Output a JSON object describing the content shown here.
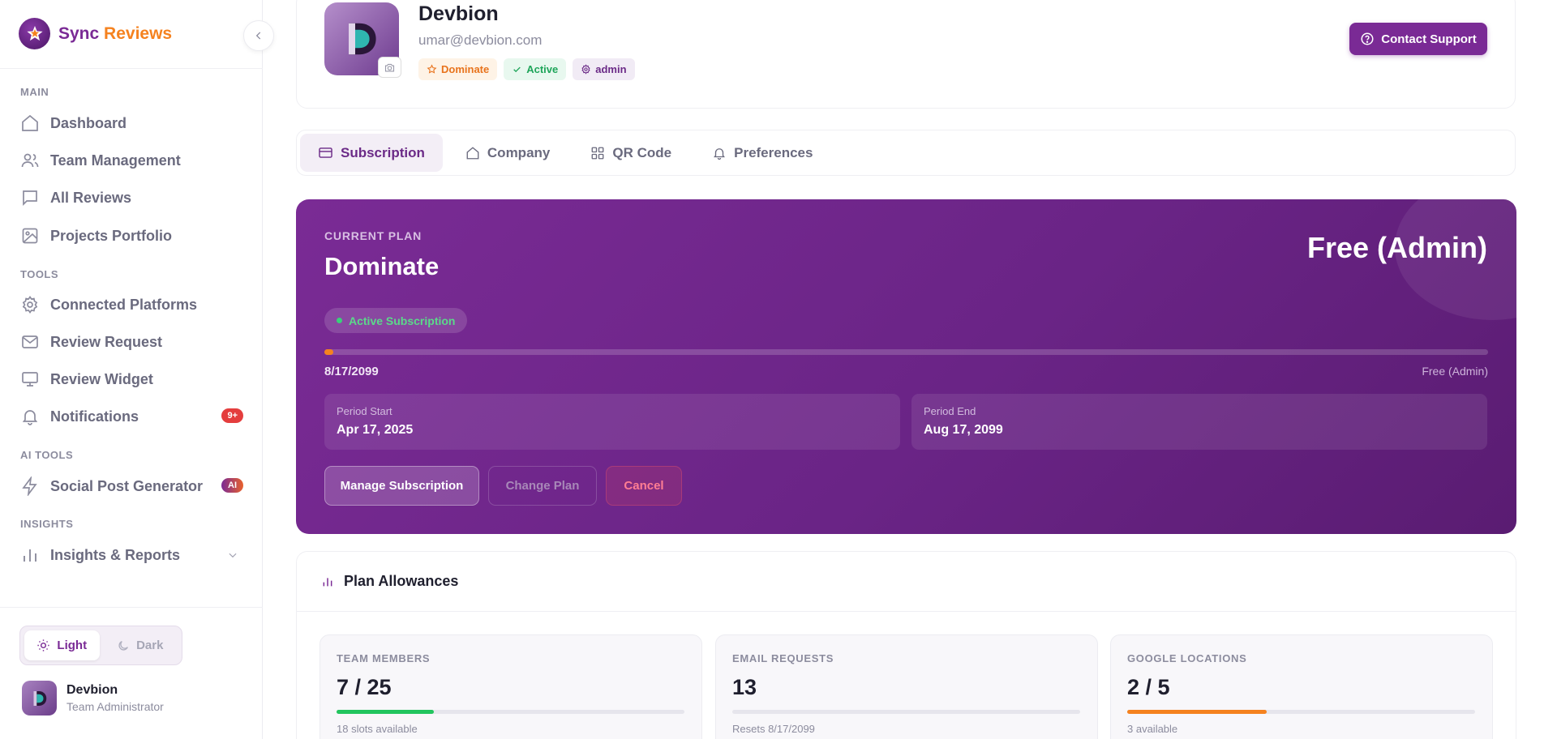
{
  "brand": {
    "name_part1": "Sync",
    "name_part2": "Reviews"
  },
  "sidebar": {
    "sections": {
      "main": "MAIN",
      "tools": "TOOLS",
      "ai_tools": "AI TOOLS",
      "insights": "INSIGHTS"
    },
    "items": {
      "dashboard": "Dashboard",
      "team": "Team Management",
      "reviews": "All Reviews",
      "portfolio": "Projects Portfolio",
      "platforms": "Connected Platforms",
      "review_request": "Review Request",
      "review_widget": "Review Widget",
      "notifications": "Notifications",
      "notifications_badge": "9+",
      "social_post": "Social Post Generator",
      "social_post_badge": "AI",
      "insights_reports": "Insights & Reports"
    },
    "theme": {
      "light": "Light",
      "dark": "Dark",
      "selected": "Light"
    },
    "user": {
      "name": "Devbion",
      "role": "Team Administrator"
    }
  },
  "profile": {
    "name": "Devbion",
    "email": "umar@devbion.com",
    "tags": {
      "plan": "Dominate",
      "status": "Active",
      "role": "admin"
    },
    "support_label": "Contact Support"
  },
  "tabs": {
    "subscription": "Subscription",
    "company": "Company",
    "qr_code": "QR Code",
    "preferences": "Preferences",
    "active": "Subscription"
  },
  "plan": {
    "label": "CURRENT PLAN",
    "name": "Dominate",
    "price": "Free (Admin)",
    "status": "Active Subscription",
    "progress_fraction": 0.008,
    "progress_left": "8/17/2099",
    "progress_right": "Free (Admin)",
    "period_start_label": "Period Start",
    "period_start": "Apr 17, 2025",
    "period_end_label": "Period End",
    "period_end": "Aug 17, 2099",
    "buttons": {
      "manage": "Manage Subscription",
      "change": "Change Plan",
      "cancel": "Cancel"
    }
  },
  "allowances": {
    "title": "Plan Allowances",
    "items": [
      {
        "label": "TEAM MEMBERS",
        "value": "7 / 25",
        "sub": "18 slots available",
        "fraction": 0.28,
        "color": "#22c55e"
      },
      {
        "label": "EMAIL REQUESTS",
        "value": "13",
        "sub": "Resets 8/17/2099",
        "fraction": 0,
        "color": "#e6e5ec"
      },
      {
        "label": "GOOGLE LOCATIONS",
        "value": "2 / 5",
        "sub": "3 available",
        "fraction": 0.4,
        "color": "#f5821f"
      }
    ]
  },
  "colors": {
    "brand": "#7a2a95",
    "accent": "#f5821f",
    "plan_gradient_start": "#7a2b95",
    "plan_gradient_end": "#5a1c72"
  }
}
